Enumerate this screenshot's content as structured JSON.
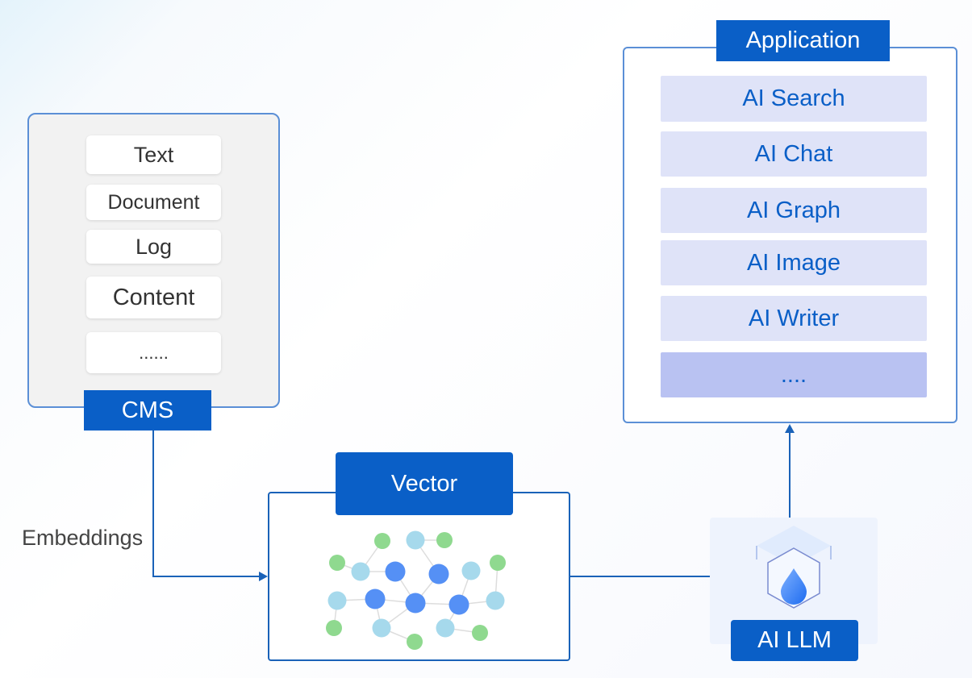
{
  "sources": {
    "items": [
      "Text",
      "Document",
      "Log",
      "Content",
      "......"
    ],
    "label": "CMS"
  },
  "edge_label": "Embeddings",
  "vector": {
    "label": "Vector"
  },
  "llm": {
    "label": "AI LLM"
  },
  "application": {
    "label": "Application",
    "items": [
      "AI Search",
      "AI  Chat",
      "AI Graph",
      "AI Image",
      "AI Writer",
      "...."
    ]
  },
  "colors": {
    "primary": "#0a5fc7",
    "node_blue": "#5590f5",
    "node_light": "#a6d9ec",
    "node_green": "#8fd98f"
  }
}
